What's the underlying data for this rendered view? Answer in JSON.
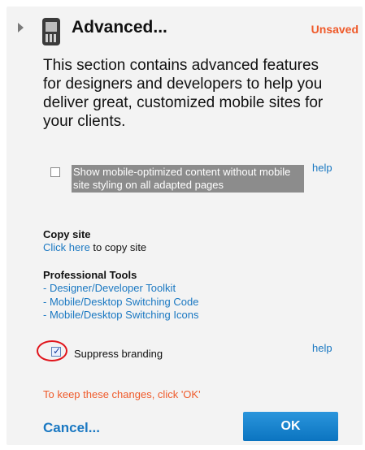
{
  "header": {
    "title": "Advanced...",
    "status": "Unsaved"
  },
  "description": "This section contains advanced features for designers and developers to help you deliver great, customized mobile sites for your clients.",
  "mobile_option": {
    "label": "Show mobile-optimized content without mobile site styling on all adapted pages",
    "checked": false,
    "help": "help"
  },
  "copy_site": {
    "heading": "Copy site",
    "link": "Click here",
    "suffix": " to copy site"
  },
  "pro_tools": {
    "heading": "Professional Tools",
    "links": [
      "- Designer/Developer Toolkit",
      "- Mobile/Desktop Switching Code",
      "- Mobile/Desktop Switching Icons"
    ]
  },
  "suppress": {
    "label": "Suppress branding",
    "checked": true,
    "help": "help"
  },
  "notice": "To keep these changes, click 'OK'",
  "actions": {
    "cancel": "Cancel...",
    "ok": "OK"
  },
  "colors": {
    "accent_blue": "#1a78c2",
    "warning_orange": "#ef5a2a",
    "highlight_red": "#e0141b"
  }
}
